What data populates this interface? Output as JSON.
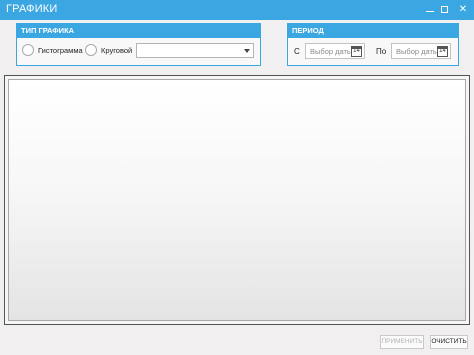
{
  "window": {
    "title": "ГРАФИКИ",
    "minimize_icon": "minimize-icon",
    "maximize_icon": "maximize-icon",
    "close_icon": "close-icon",
    "close_glyph": "✕",
    "accent_color": "#3aa7e2"
  },
  "chart_type": {
    "header": "ТИП ГРАФИКА",
    "options": [
      {
        "label": "Гистограмма",
        "selected": false
      },
      {
        "label": "Круговой",
        "selected": false
      }
    ],
    "combo_value": ""
  },
  "period": {
    "header": "ПЕРИОД",
    "from_label": "С",
    "to_label": "По",
    "from_placeholder": "Выбор даты",
    "to_placeholder": "Выбор даты",
    "calendar_icon": "calendar-icon",
    "calendar_glyph": "14"
  },
  "actions": {
    "apply": "ПРИМЕНИТЬ",
    "clear": "ОЧИСТИТЬ"
  }
}
